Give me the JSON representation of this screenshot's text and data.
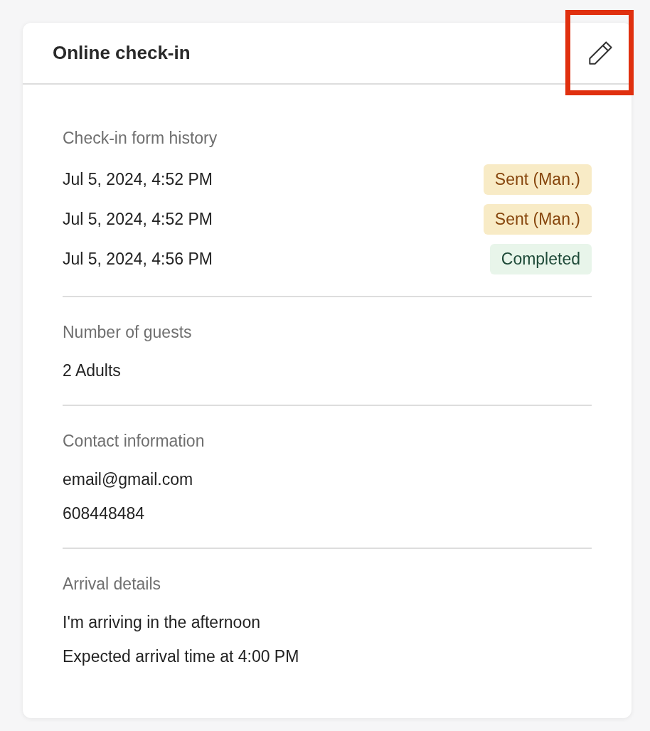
{
  "card": {
    "title": "Online check-in",
    "edit_button": {
      "highlighted": true
    }
  },
  "history": {
    "label": "Check-in form history",
    "entries": [
      {
        "time": "Jul 5, 2024, 4:52 PM",
        "status": "Sent (Man.)",
        "kind": "sent"
      },
      {
        "time": "Jul 5, 2024, 4:52 PM",
        "status": "Sent (Man.)",
        "kind": "sent"
      },
      {
        "time": "Jul 5, 2024, 4:56 PM",
        "status": "Completed",
        "kind": "completed"
      }
    ]
  },
  "sections": [
    {
      "label": "Number of guests",
      "lines": [
        "2 Adults"
      ]
    },
    {
      "label": "Contact information",
      "lines": [
        "email@gmail.com",
        "608448484"
      ]
    },
    {
      "label": "Arrival details",
      "lines": [
        "I'm arriving in the afternoon",
        "Expected arrival time at 4:00 PM"
      ]
    }
  ]
}
